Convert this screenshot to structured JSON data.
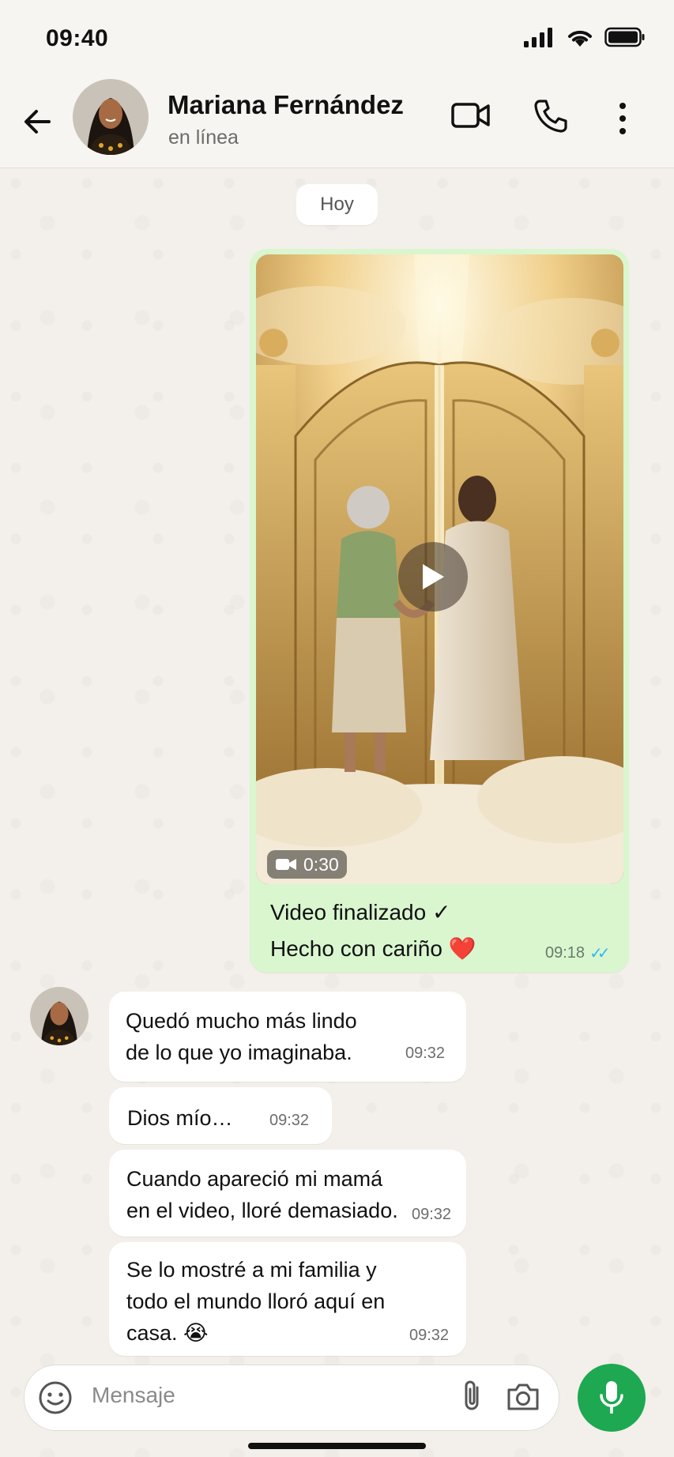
{
  "status_bar": {
    "time": "09:40"
  },
  "header": {
    "contact_name": "Mariana Fernández",
    "contact_status": "en línea"
  },
  "chat": {
    "date_chip": "Hoy",
    "outgoing": {
      "video_duration": "0:30",
      "line1": "Video finalizado ✓",
      "line2": "Hecho con cariño ❤️",
      "time": "09:18",
      "read_receipt": "✓✓"
    },
    "incoming": [
      {
        "text": "Quedó mucho más lindo\nde lo que yo imaginaba.",
        "time": "09:32"
      },
      {
        "text": "Dios mío…",
        "time": "09:32"
      },
      {
        "text": "Cuando apareció mi mamá\nen el video, lloré demasiado.",
        "time": "09:32"
      },
      {
        "text": "Se lo mostré a mi familia y\ntodo el mundo lloró aquí en\ncasa. 😭",
        "time": "09:32"
      }
    ]
  },
  "composer": {
    "placeholder": "Mensaje"
  },
  "colors": {
    "outgoing_bubble": "#d9f6cf",
    "accent_green": "#1da851",
    "read_tick_blue": "#34b7f1"
  },
  "icons": [
    "back-arrow-icon",
    "video-call-icon",
    "phone-icon",
    "more-options-icon",
    "play-icon",
    "video-camera-icon",
    "emoji-icon",
    "attach-icon",
    "camera-icon",
    "mic-icon",
    "signal-icon",
    "wifi-icon",
    "battery-icon"
  ]
}
